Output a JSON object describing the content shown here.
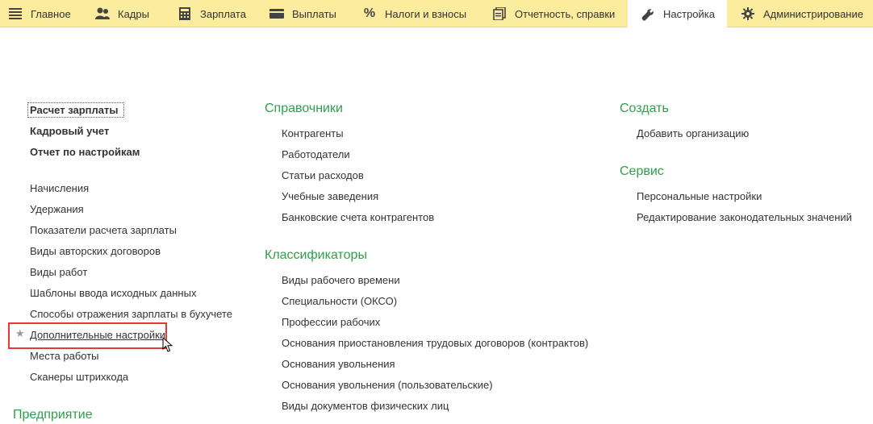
{
  "tabs": [
    {
      "label": "Главное",
      "icon": "menu-icon"
    },
    {
      "label": "Кадры",
      "icon": "people-icon"
    },
    {
      "label": "Зарплата",
      "icon": "calculator-icon"
    },
    {
      "label": "Выплаты",
      "icon": "card-icon"
    },
    {
      "label": "Налоги и взносы",
      "icon": "percent-icon"
    },
    {
      "label": "Отчетность, справки",
      "icon": "reports-icon"
    },
    {
      "label": "Настройка",
      "icon": "wrench-icon",
      "active": true
    },
    {
      "label": "Администрирование",
      "icon": "gear-icon"
    }
  ],
  "left": {
    "bold_links": [
      "Расчет зарплаты",
      "Кадровый учет",
      "Отчет по настройкам"
    ],
    "links": [
      "Начисления",
      "Удержания",
      "Показатели расчета зарплаты",
      "Виды авторских договоров",
      "Виды работ",
      "Шаблоны ввода исходных данных",
      "Способы отражения зарплаты в бухучете",
      "Дополнительные настройки",
      "Места работы",
      "Сканеры штрихкода"
    ],
    "section_heading": "Предприятие"
  },
  "middle": {
    "heading1": "Справочники",
    "links1": [
      "Контрагенты",
      "Работодатели",
      "Статьи расходов",
      "Учебные заведения",
      "Банковские счета контрагентов"
    ],
    "heading2": "Классификаторы",
    "links2": [
      "Виды рабочего времени",
      "Специальности (ОКСО)",
      "Профессии рабочих",
      "Основания приостановления трудовых договоров (контрактов)",
      "Основания увольнения",
      "Основания увольнения (пользовательские)",
      "Виды документов физических лиц"
    ]
  },
  "right": {
    "heading1": "Создать",
    "links1": [
      "Добавить организацию"
    ],
    "heading2": "Сервис",
    "links2": [
      "Персональные настройки",
      "Редактирование законодательных значений"
    ]
  },
  "colors": {
    "topbar": "#fbec9e",
    "heading": "#2f9f4b",
    "highlight": "#e53935"
  }
}
